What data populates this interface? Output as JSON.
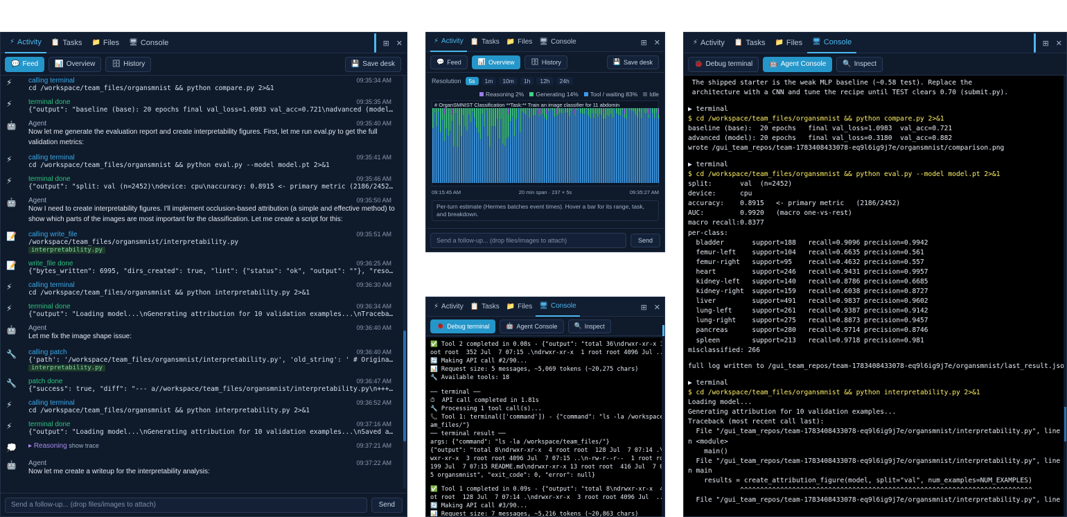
{
  "left": {
    "tabs": [
      {
        "icon": "⚡",
        "label": "Activity"
      },
      {
        "icon": "📋",
        "label": "Tasks"
      },
      {
        "icon": "📁",
        "label": "Files"
      },
      {
        "icon": "🖥",
        "label": "Console"
      }
    ],
    "subtabs": [
      {
        "icon": "💬",
        "label": "Feed"
      },
      {
        "icon": "📊",
        "label": "Overview"
      },
      {
        "icon": "🗄",
        "label": "History"
      }
    ],
    "save_desk": "Save desk",
    "feed": [
      {
        "kind": "call",
        "icon": "⚡",
        "title": "calling terminal",
        "time": "09:35:34 AM",
        "body": "cd /workspace/team_files/organsmnist && python compare.py 2>&1"
      },
      {
        "kind": "done",
        "icon": "⚡",
        "title": "terminal done",
        "time": "09:35:35 AM",
        "body": "{\"output\": \"baseline (base): 20 epochs final val_loss=1.0983 val_acc=0.721\\nadvanced (model): 20 epochs final val_loss=0..."
      },
      {
        "kind": "agent",
        "icon": "🤖",
        "title": "Agent",
        "time": "09:35:40 AM",
        "body": "Now let me generate the evaluation report and create interpretability figures. First, let me run eval.py to get the full validation metrics:"
      },
      {
        "kind": "call",
        "icon": "⚡",
        "title": "calling terminal",
        "time": "09:35:41 AM",
        "body": "cd /workspace/team_files/organsmnist && python eval.py --model model.pt 2>&1"
      },
      {
        "kind": "done",
        "icon": "⚡",
        "title": "terminal done",
        "time": "09:35:46 AM",
        "body": "{\"output\": \"split: val (n=2452)\\ndevice: cpu\\naccuracy: 0.8915 <- primary metric (2186/2452)\\nAUC: 0.9920 (macro one-v..."
      },
      {
        "kind": "agent",
        "icon": "🤖",
        "title": "Agent",
        "time": "09:35:50 AM",
        "body": "Now I need to create interpretability figures. I'll implement occlusion-based attribution (a simple and effective method) to show which parts of the images are most important for the classification. Let me create a script for this:"
      },
      {
        "kind": "call",
        "icon": "📝",
        "title": "calling write_file",
        "time": "09:35:51 AM",
        "body": "/workspace/team_files/organsmnist/interpretability.py",
        "tag": "interpretability.py"
      },
      {
        "kind": "done",
        "icon": "📝",
        "title": "write_file done",
        "time": "09:36:25 AM",
        "body": "{\"bytes_written\": 6995, \"dirs_created\": true, \"lint\": {\"status\": \"ok\", \"output\": \"\"}, \"resolved_path\": \"/workspace/team_files/..."
      },
      {
        "kind": "call",
        "icon": "⚡",
        "title": "calling terminal",
        "time": "09:36:30 AM",
        "body": "cd /workspace/team_files/organsmnist && python interpretability.py 2>&1"
      },
      {
        "kind": "done",
        "icon": "⚡",
        "title": "terminal done",
        "time": "09:36:34 AM",
        "body": "{\"output\": \"Loading model...\\nGenerating attribution for 10 validation examples...\\nTraceback (most recent call last):\\n File \\..."
      },
      {
        "kind": "agent",
        "icon": "🤖",
        "title": "Agent",
        "time": "09:36:40 AM",
        "body": "Let me fix the image shape issue:"
      },
      {
        "kind": "call",
        "icon": "🔧",
        "title": "calling patch",
        "time": "09:36:40 AM",
        "body": "{'path': '/workspace/team_files/organsmnist/interpretability.py', 'old_string': ' # Original image...",
        "tag": "interpretability.py"
      },
      {
        "kind": "done",
        "icon": "🔧",
        "title": "patch done",
        "time": "09:36:47 AM",
        "body": "{\"success\": true, \"diff\": \"--- a//workspace/team_files/organsmnist/interpretability.py\\n+++ b//workspace/team_files/organs..."
      },
      {
        "kind": "call",
        "icon": "⚡",
        "title": "calling terminal",
        "time": "09:36:52 AM",
        "body": "cd /workspace/team_files/organsmnist && python interpretability.py 2>&1"
      },
      {
        "kind": "done",
        "icon": "⚡",
        "title": "terminal done",
        "time": "09:37:16 AM",
        "body": "{\"output\": \"Loading model...\\nGenerating attribution for 10 validation examples...\\nSaved attribution figure to /gui_team_re..."
      },
      {
        "kind": "reason",
        "icon": "💭",
        "title": "Reasoning",
        "time": "09:37:21 AM",
        "extra": "show trace"
      },
      {
        "kind": "agent",
        "icon": "🤖",
        "title": "Agent",
        "time": "09:37:22 AM",
        "body": "Now let me create a writeup for the interpretability analysis:"
      }
    ],
    "input_placeholder": "Send a follow-up...  (drop files/images to attach)",
    "send": "Send"
  },
  "mid_top": {
    "tabs": [
      {
        "icon": "⚡",
        "label": "Activity"
      },
      {
        "icon": "📋",
        "label": "Tasks"
      },
      {
        "icon": "📁",
        "label": "Files"
      },
      {
        "icon": "🖥",
        "label": "Console"
      }
    ],
    "subtabs": [
      {
        "icon": "💬",
        "label": "Feed"
      },
      {
        "icon": "📊",
        "label": "Overview"
      },
      {
        "icon": "🗄",
        "label": "History"
      }
    ],
    "save_desk": "Save desk",
    "resolution_label": "Resolution",
    "resolutions": [
      "5s",
      "1m",
      "10m",
      "1h",
      "12h",
      "24h"
    ],
    "legend": [
      {
        "label": "Reasoning 2%",
        "color": "#9b7ce6"
      },
      {
        "label": "Generating 14%",
        "color": "#43d08b"
      },
      {
        "label": "Tool / waiting 83%",
        "color": "#3d9be9"
      },
      {
        "label": "Idle",
        "color": "#4a5568"
      }
    ],
    "chart_title": "# OrganSMNIST Classification **Task:** Train an image classifier for 11 abdomin",
    "x_start": "09:15:45 AM",
    "x_mid": "20 min span · 237 × 5s",
    "x_end": "09:35:27 AM",
    "note": "Per-turn estimate (Hermes batches event times). Hover a bar for its range, task, and breakdown.",
    "input_placeholder": "Send a follow-up...  (drop files/images to attach)",
    "send": "Send"
  },
  "mid_bottom": {
    "tabs": [
      {
        "icon": "⚡",
        "label": "Activity"
      },
      {
        "icon": "📋",
        "label": "Tasks"
      },
      {
        "icon": "📁",
        "label": "Files"
      },
      {
        "icon": "🖥",
        "label": "Console"
      }
    ],
    "subtabs": [
      {
        "icon": "🐞",
        "label": "Debug terminal"
      },
      {
        "icon": "🤖",
        "label": "Agent Console"
      },
      {
        "icon": "🔍",
        "label": "Inspect"
      }
    ],
    "lines": [
      "✅ Tool 2 completed in 0.08s - {\"output\": \"total 36\\ndrwxr-xr-x 11 r",
      "oot root  352 Jul  7 07:15 .\\ndrwxr-xr-x  1 root root 4096 Jul ...",
      "🔄 Making API call #2/90...",
      "📊 Request size: 5 messages, ~5,069 tokens (~20,275 chars)",
      "🔧 Available tools: 18",
      "",
      "── terminal ──",
      "⏱  API call completed in 1.81s",
      "🔧 Processing 1 tool call(s)...",
      "📞 Tool 1: terminal(['command']) - {\"command\": \"ls -la /workspace/te",
      "am_files/\"}",
      "── terminal result ──",
      "args: {\"command\": \"ls -la /workspace/team_files/\"}",
      "{\"output\": \"total 8\\ndrwxr-xr-x  4 root root  128 Jul  7 07:14 .\\ndr",
      "wxr-xr-x  3 root root 4096 Jul  7 07:15 ..\\n-rw-r--r--  1 root root",
      "199 Jul  7 07:15 README.md\\ndrwxr-xr-x 13 root root  416 Jul  7 07:1",
      "5 organsmnist\", \"exit_code\": 0, \"error\": null}",
      "",
      "✅ Tool 1 completed in 0.09s - {\"output\": \"total 8\\ndrwxr-xr-x  4 ro",
      "ot root  128 Jul  7 07:14 .\\ndrwxr-xr-x  3 root root 4096 Jul  ...",
      "🔄 Making API call #3/90...",
      "📊 Request size: 7 messages, ~5,216 tokens (~20,863 chars)"
    ]
  },
  "right": {
    "tabs": [
      {
        "icon": "⚡",
        "label": "Activity"
      },
      {
        "icon": "📋",
        "label": "Tasks"
      },
      {
        "icon": "📁",
        "label": "Files"
      },
      {
        "icon": "🖥",
        "label": "Console"
      }
    ],
    "subtabs": [
      {
        "icon": "🐞",
        "label": "Debug terminal"
      },
      {
        "icon": "🤖",
        "label": "Agent Console"
      },
      {
        "icon": "🔍",
        "label": "Inspect"
      }
    ],
    "lines": [
      " The shipped starter is the weak MLP baseline (~0.58 test). Replace the",
      " architecture with a CNN and tune the recipe until TEST clears 0.70 (submit.py).",
      "",
      "▶ terminal",
      "$ cd /workspace/team_files/organsmnist && python compare.py 2>&1",
      "baseline (base):  20 epochs   final val_loss=1.0983  val_acc=0.721",
      "advanced (model): 20 epochs   final val_loss=0.3180  val_acc=0.882",
      "wrote /gui_team_repos/team-1783408433078-eq9l6ig9j7e/organsmnist/comparison.png",
      "",
      "▶ terminal",
      "$ cd /workspace/team_files/organsmnist && python eval.py --model model.pt 2>&1",
      "split:       val  (n=2452)",
      "device:      cpu",
      "accuracy:    0.8915   <- primary metric   (2186/2452)",
      "AUC:         0.9920   (macro one-vs-rest)",
      "macro recall:0.8377",
      "per-class:",
      "  bladder       support=188   recall=0.9096 precision=0.9942",
      "  femur-left    support=104   recall=0.6635 precision=0.561",
      "  femur-right   support=95    recall=0.4632 precision=0.557",
      "  heart         support=246   recall=0.9431 precision=0.9957",
      "  kidney-left   support=140   recall=0.8786 precision=0.6685",
      "  kidney-right  support=159   recall=0.6038 precision=0.8727",
      "  liver         support=491   recall=0.9837 precision=0.9602",
      "  lung-left     support=261   recall=0.9387 precision=0.9142",
      "  lung-right    support=275   recall=0.8873 precision=0.9457",
      "  pancreas      support=280   recall=0.9714 precision=0.8746",
      "  spleen        support=213   recall=0.9718 precision=0.981",
      "misclassified: 266",
      "",
      "full log written to /gui_team_repos/team-1783408433078-eq9l6ig9j7e/organsmnist/last_result.json",
      "",
      "▶ terminal",
      "$ cd /workspace/team_files/organsmnist && python interpretability.py 2>&1",
      "Loading model...",
      "Generating attribution for 10 validation examples...",
      "Traceback (most recent call last):",
      "  File \"/gui_team_repos/team-1783408433078-eq9l6ig9j7e/organsmnist/interpretability.py\", line 206, i",
      "n <module>",
      "    main()",
      "  File \"/gui_team_repos/team-1783408433078-eq9l6ig9j7e/organsmnist/interpretability.py\", line 193, i",
      "n main",
      "    results = create_attribution_figure(model, split=\"val\", num_examples=NUM_EXAMPLES)",
      "             ^^^^^^^^^^^^^^^^^^^^^^^^^^^^^^^^^^^^^^^^^^^^^^^^^^^^^^^^^^^^^^^^^^^^^^^^^",
      "  File \"/gui_team_repos/team-1783408433078-eq9l6ig9j7e/organsmnist/interpretability.py\", line 134, i"
    ]
  }
}
